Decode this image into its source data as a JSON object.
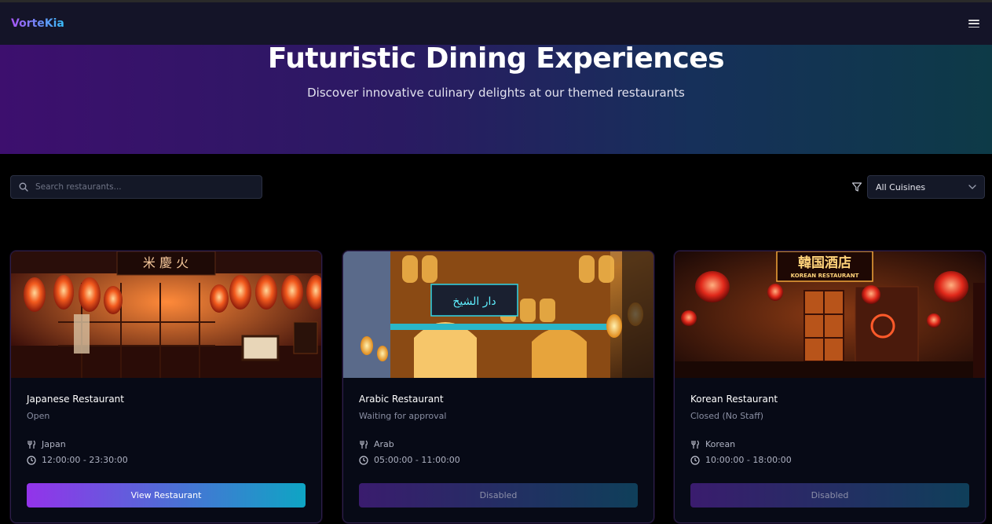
{
  "app": {
    "brand": "VorteKia"
  },
  "hero": {
    "title": "Futuristic Dining Experiences",
    "subtitle": "Discover innovative culinary delights at our themed restaurants"
  },
  "search": {
    "placeholder": "Search restaurants..."
  },
  "filter": {
    "selected": "All Cuisines"
  },
  "restaurants": [
    {
      "name": "Japanese Restaurant",
      "status": "Open",
      "cuisine": "Japan",
      "hours": "12:00:00 - 23:30:00",
      "button": "View Restaurant",
      "enabled": true
    },
    {
      "name": "Arabic Restaurant",
      "status": "Waiting for approval",
      "cuisine": "Arab",
      "hours": "05:00:00 - 11:00:00",
      "button": "Disabled",
      "enabled": false
    },
    {
      "name": "Korean Restaurant",
      "status": "Closed (No Staff)",
      "cuisine": "Korean",
      "hours": "10:00:00 - 18:00:00",
      "button": "Disabled",
      "enabled": false
    }
  ],
  "images": {
    "japanese_sign": "米 慶 火",
    "korean_sign": "韓国酒店",
    "korean_sign_sub": "KOREAN RESTAURANT",
    "arabic_sign": "دار الشيخ"
  },
  "colors": {
    "accent_start": "#9333ea",
    "accent_end": "#0ea5c4",
    "background": "#000000"
  }
}
